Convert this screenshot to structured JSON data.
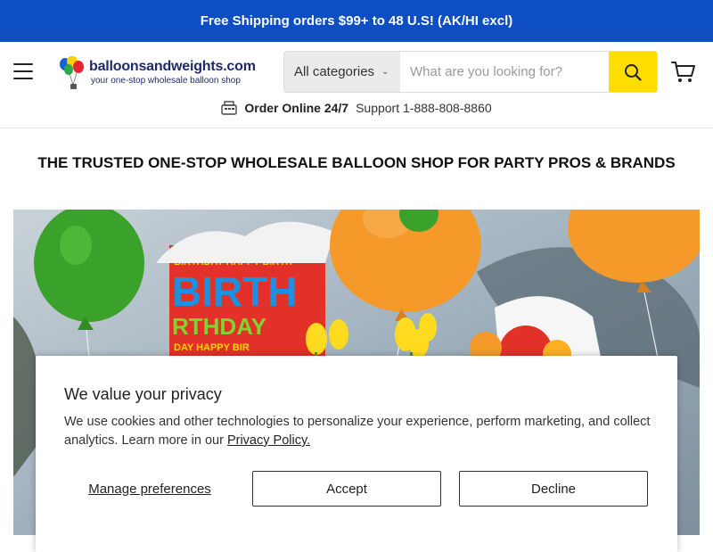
{
  "announcement": "Free Shipping orders $99+ to 48 U.S! (AK/HI excl)",
  "logo": {
    "name": "balloonsandweights.com",
    "tagline": "your one-stop wholesale balloon shop"
  },
  "search": {
    "category": "All categories",
    "placeholder": "What are you looking for?"
  },
  "subline": {
    "order": "Order Online 24/7",
    "support": "Support 1-888-808-8860"
  },
  "hero_title": "THE TRUSTED ONE-STOP WHOLESALE BALLOON SHOP FOR PARTY PROS & BRANDS",
  "hero_image_text": "BIRTHDAY HAPPY BIRTHDAY",
  "cookie": {
    "title": "We value your privacy",
    "body": "We use cookies and other technologies to personalize your experience, perform marketing, and collect analytics. Learn more in our ",
    "link": "Privacy Policy.",
    "manage": "Manage preferences",
    "accept": "Accept",
    "decline": "Decline"
  },
  "colors": {
    "announce_bg": "#0d4ec2",
    "search_button": "#ffdd00",
    "logo_text": "#1f2a6a"
  }
}
